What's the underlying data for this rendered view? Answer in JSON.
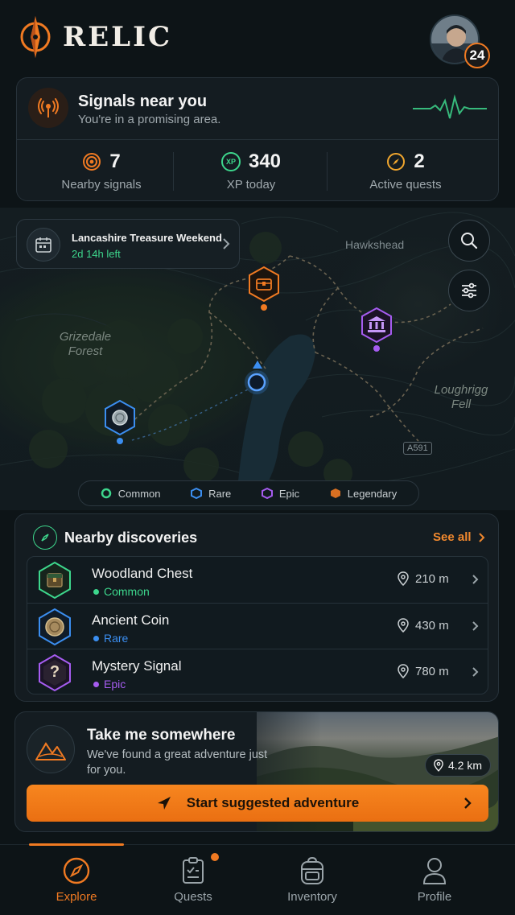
{
  "app": {
    "name": "RELIC",
    "avatar_badge": "24"
  },
  "signals": {
    "title": "Signals near you",
    "subtitle": "You're in a promising area.",
    "stats": [
      {
        "value": "7",
        "label": "Nearby signals",
        "icon": "target-icon"
      },
      {
        "value": "340",
        "label": "XP today",
        "icon": "xp-icon",
        "icon_text": "XP"
      },
      {
        "value": "2",
        "label": "Active quests",
        "icon": "compass-icon"
      }
    ]
  },
  "map": {
    "event": {
      "title": "Lancashire Treasure Weekend",
      "time_left": "2d 14h left"
    },
    "labels": {
      "hawkshead": "Hawkshead",
      "grizedale_1": "Grizedale",
      "grizedale_2": "Forest",
      "loughrigg_1": "Loughrigg",
      "loughrigg_2": "Fell",
      "road": "A591"
    },
    "legend": [
      {
        "label": "Common",
        "color": "#3dd68c"
      },
      {
        "label": "Rare",
        "color": "#3b8ef0"
      },
      {
        "label": "Epic",
        "color": "#a65cf0"
      },
      {
        "label": "Legendary",
        "color": "#f07a22"
      }
    ]
  },
  "discoveries": {
    "title": "Nearby discoveries",
    "see_all": "See all",
    "items": [
      {
        "name": "Woodland Chest",
        "rarity": "Common",
        "distance": "210 m",
        "color": "#3dd68c",
        "icon": "chest-icon"
      },
      {
        "name": "Ancient Coin",
        "rarity": "Rare",
        "distance": "430 m",
        "color": "#3b8ef0",
        "icon": "coin-icon"
      },
      {
        "name": "Mystery Signal",
        "rarity": "Epic",
        "distance": "780 m",
        "color": "#a65cf0",
        "icon": "question-icon",
        "glyph": "?"
      }
    ]
  },
  "adventure": {
    "title": "Take me somewhere",
    "subtitle": "We've found a great adventure just for you.",
    "distance": "4.2 km",
    "button": "Start suggested adventure"
  },
  "nav": {
    "items": [
      {
        "label": "Explore",
        "active": true
      },
      {
        "label": "Quests"
      },
      {
        "label": "Inventory"
      },
      {
        "label": "Profile"
      }
    ]
  }
}
